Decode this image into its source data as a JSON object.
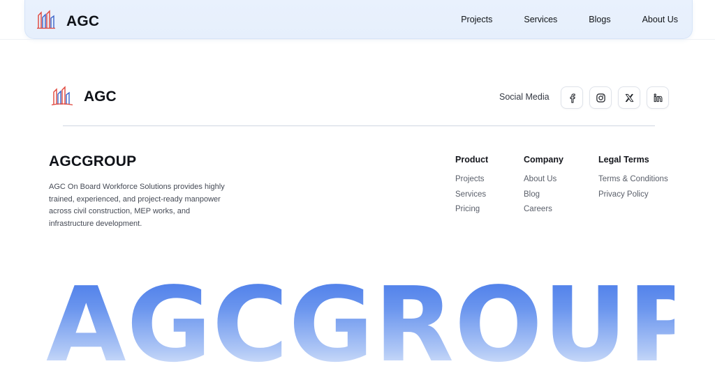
{
  "nav": {
    "brand": "AGC",
    "links": [
      "Projects",
      "Services",
      "Blogs",
      "About Us"
    ]
  },
  "footer": {
    "brand": "AGC",
    "social_label": "Social Media",
    "social_icons": [
      "facebook-icon",
      "instagram-icon",
      "x-icon",
      "linkedin-icon"
    ],
    "about_title": "AGCGROUP",
    "about_text": "AGC On Board Workforce Solutions provides highly trained, experienced, and project-ready manpower across civil construction, MEP works, and infrastructure development.",
    "columns": [
      {
        "title": "Product",
        "links": [
          "Projects",
          "Services",
          "Pricing"
        ]
      },
      {
        "title": "Company",
        "links": [
          "About Us",
          "Blog",
          "Careers"
        ]
      },
      {
        "title": "Legal Terms",
        "links": [
          "Terms & Conditions",
          "Privacy Policy"
        ]
      }
    ],
    "big_word": "AGCGROUP"
  },
  "colors": {
    "accent": "#4477e8",
    "logo_red": "#e0443a",
    "logo_blue": "#3a63c9",
    "nav_bg": "#e9f1fd"
  }
}
